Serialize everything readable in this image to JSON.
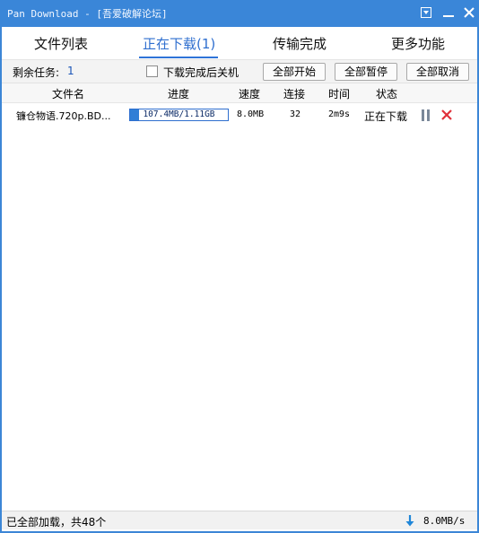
{
  "window": {
    "title": "Pan Download - [吾爱破解论坛]"
  },
  "tabs": [
    {
      "label": "文件列表",
      "active": false
    },
    {
      "label": "正在下载(1)",
      "active": true
    },
    {
      "label": "传输完成",
      "active": false
    },
    {
      "label": "更多功能",
      "active": false
    }
  ],
  "toolbar": {
    "remaining_label": "剩余任务:",
    "remaining_count": "1",
    "shutdown_checkbox_label": "下载完成后关机",
    "shutdown_checked": false,
    "start_all": "全部开始",
    "pause_all": "全部暂停",
    "cancel_all": "全部取消"
  },
  "table": {
    "columns": [
      "文件名",
      "进度",
      "速度",
      "连接",
      "时间",
      "状态"
    ],
    "rows": [
      {
        "filename": "镰仓物语.720p.BD...",
        "progress_text": "107.4MB/1.11GB",
        "progress_fraction": 0.095,
        "speed": "8.0MB",
        "connections": "32",
        "time": "2m9s",
        "status": "正在下载"
      }
    ]
  },
  "statusbar": {
    "left_text": "已全部加载，共48个",
    "speed": "8.0MB/s"
  },
  "colors": {
    "titlebar": "#3a86d8",
    "accent": "#2f6fcf",
    "progress_fill": "#2f7fd6",
    "cancel_red": "#e0303a",
    "download_arrow": "#1f86d8"
  },
  "icons": {
    "menu": "dropdown-menu-icon",
    "minimize": "minimize-icon",
    "close": "close-icon",
    "pause": "pause-icon",
    "cancel": "cancel-x-icon",
    "download": "download-arrow-icon"
  }
}
